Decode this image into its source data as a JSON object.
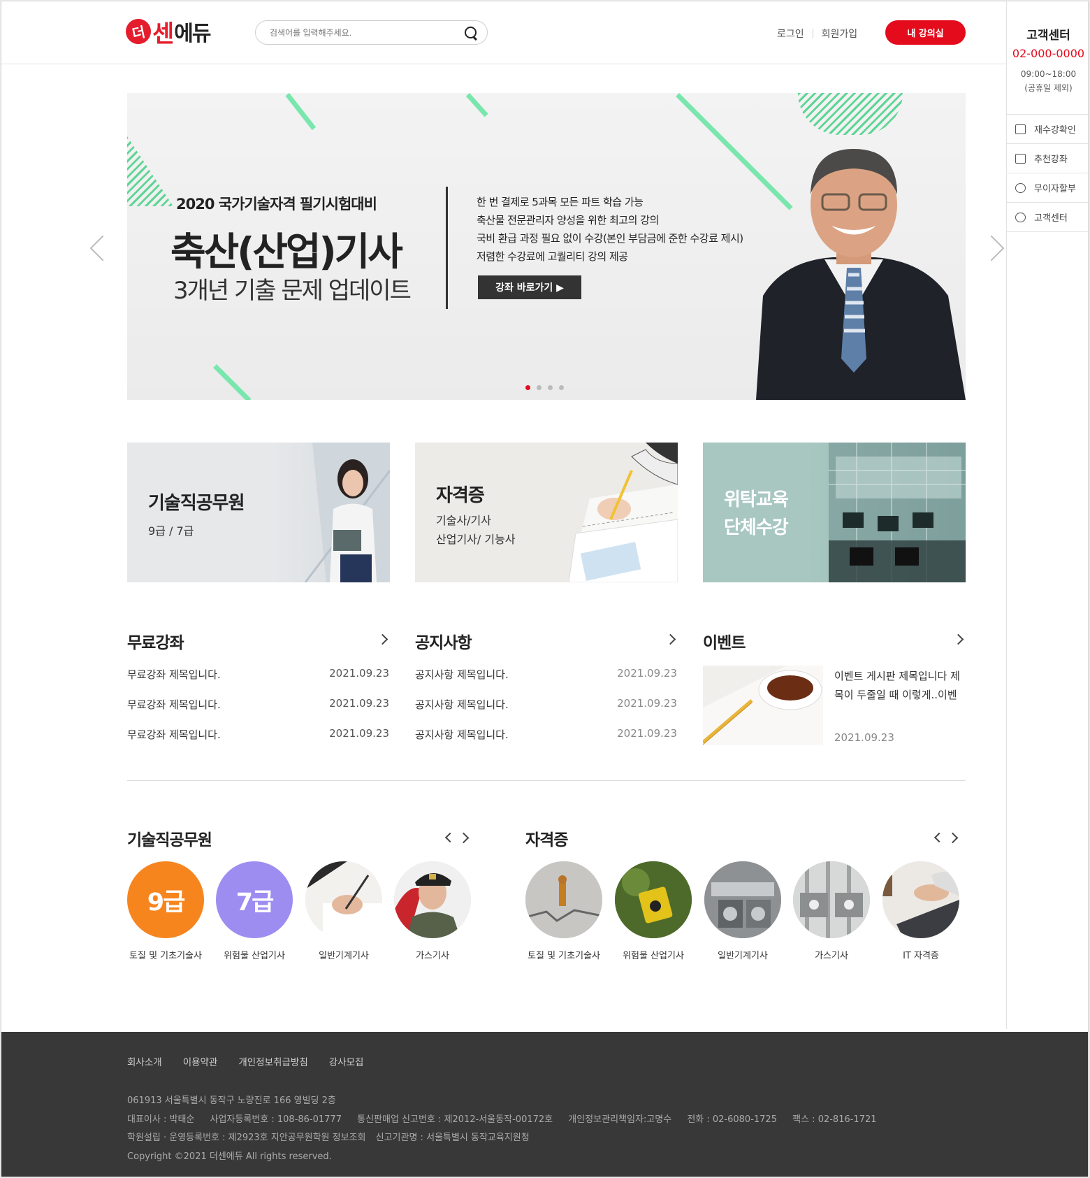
{
  "header": {
    "logo": {
      "mark": "더",
      "brand_main": "센",
      "brand_sub": "에듀"
    },
    "search_placeholder": "검색어를 입력해주세요.",
    "login": "로그인",
    "signup": "회원가입",
    "my_class": "내 강의실"
  },
  "sidebar": {
    "title": "고객센터",
    "phone": "02-000-0000",
    "hours": "09:00~18:00",
    "hours_note": "(공휴일 제외)",
    "items": [
      {
        "label": "재수강확인",
        "icon": "calendar-icon"
      },
      {
        "label": "추천강좌",
        "icon": "presentation-icon"
      },
      {
        "label": "무이자할부",
        "icon": "piggy-bank-icon"
      },
      {
        "label": "고객센터",
        "icon": "chat-bubble-icon"
      }
    ]
  },
  "hero": {
    "subtitle": "2020 국가기술자격 필기시험대비",
    "title": "축산(산업)기사",
    "tagline": "3개년 기출 문제 업데이트",
    "features": [
      "한 번 결제로 5과목 모든 파트 학습 가능",
      "축산물 전문관리자 양성을 위한 최고의 강의",
      "국비 환급 과정 필요 없이 수강(본인 부담금에 준한 수강료 제시)",
      "저렴한 수강료에 고퀄리티 강의 제공"
    ],
    "cta": "강좌 바로가기 ▶",
    "slides": 4,
    "active_slide": 1
  },
  "categories": [
    {
      "title": "기술직공무원",
      "sub": [
        "9급 / 7급"
      ]
    },
    {
      "title": "자격증",
      "sub": [
        "기술사/기사",
        "산업기사/ 기능사"
      ]
    },
    {
      "title": "위탁교육\n단체수강",
      "title_lines": [
        "위탁교육",
        "단체수강"
      ],
      "sub": []
    }
  ],
  "free_lectures": {
    "title": "무료강좌",
    "items": [
      {
        "title": "무료강좌 제목입니다.",
        "date": "2021.09.23"
      },
      {
        "title": "무료강좌 제목입니다.",
        "date": "2021.09.23"
      },
      {
        "title": "무료강좌 제목입니다.",
        "date": "2021.09.23"
      }
    ]
  },
  "notices": {
    "title": "공지사항",
    "items": [
      {
        "title": "공지사항 제목입니다.",
        "date": "2021.09.23"
      },
      {
        "title": "공지사항 제목입니다.",
        "date": "2021.09.23"
      },
      {
        "title": "공지사항 제목입니다.",
        "date": "2021.09.23"
      }
    ]
  },
  "events": {
    "title": "이벤트",
    "item_title": "이벤트 게시판 제목입니다 제목이 두줄일 때 이렇게..이벤",
    "item_title_lines": [
      "이벤트 게시판 제목입니다 제",
      "목이 두줄일 때 이렇게..이벤"
    ],
    "item_date": "2021.09.23"
  },
  "gov_courses": {
    "title": "기술직공무원",
    "items": [
      {
        "label": "토질 및 기초기술사",
        "badge": "9급",
        "color": "#f7851e"
      },
      {
        "label": "위험물 산업기사",
        "badge": "7급",
        "color": "#9d8df1"
      },
      {
        "label": "일반기계기사",
        "badge": ""
      },
      {
        "label": "가스기사",
        "badge": ""
      }
    ]
  },
  "cert_courses": {
    "title": "자격증",
    "items": [
      {
        "label": "토질 및 기초기술사"
      },
      {
        "label": "위험물 산업기사"
      },
      {
        "label": "일반기계기사"
      },
      {
        "label": "가스기사"
      },
      {
        "label": "IT 자격증"
      }
    ]
  },
  "footer": {
    "nav": [
      "회사소개",
      "이용약관",
      "개인정보취급방침",
      "강사모집"
    ],
    "address": "061913 서울특별시 동작구 노량진로 166 영빌딩 2층",
    "line2": [
      "대표이사 : 박태순",
      "사업자등록번호 : 108-86-01777",
      "통신판매업 신고번호 : 제2012-서울동작-00172호",
      "개인정보관리책임자:고명수",
      "전화 : 02-6080-1725",
      "팩스 : 02-816-1721"
    ],
    "line3": [
      "학원설립 · 운영등록번호 : 제2923호 지안공무원학원 정보조회",
      "신고기관명 : 서울특별시 동작교육지원청"
    ],
    "copyright": "Copyright ©2021 더센에듀 All rights reserved."
  },
  "colors": {
    "accent": "#e40b1c",
    "green_stripe": "#79e7ad",
    "footer_bg": "#383838"
  }
}
